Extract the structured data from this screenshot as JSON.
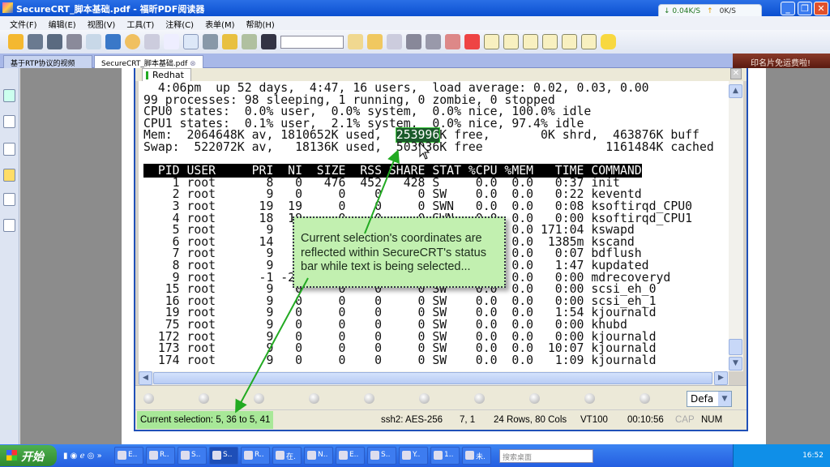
{
  "window": {
    "title": "SecureCRT_脚本基础.pdf - 福昕PDF阅读器",
    "minimize": "_",
    "restore": "❐",
    "close": "✕"
  },
  "netmon": {
    "down": "↓ 0.04K/S",
    "up": "↑",
    "up_value": "0K/S"
  },
  "menu": [
    "文件(F)",
    "编辑(E)",
    "视图(V)",
    "工具(T)",
    "注释(C)",
    "表单(M)",
    "帮助(H)"
  ],
  "tabs": [
    {
      "label": "基于RTP协议的视频流..."
    },
    {
      "label": "SecureCRT_脚本基础.pdf"
    }
  ],
  "ad": "印名片免运费啦!",
  "crt": {
    "session_tab": "Redhat",
    "terminal_top": [
      "  4:06pm  up 52 days,  4:47, 16 users,  load average: 0.02, 0.03, 0.00",
      "99 processes: 98 sleeping, 1 running, 0 zombie, 0 stopped",
      "CPU0 states:  0.0% user,  0.0% system,  0.0% nice, 100.0% idle",
      "CPU1 states:  0.1% user,  2.1% system,  0.0% nice, 97.4% idle"
    ],
    "mem_before": "Mem:  2064648K av, 1810652K used,  ",
    "mem_selected": "253996",
    "mem_after": "K free,       0K shrd,  463876K buff",
    "swap": "Swap:  522072K av,   18136K used,  503936K free                 1161484K cached",
    "header": "  PID USER     PRI  NI  SIZE  RSS SHARE STAT %CPU %MEM   TIME COMMAND",
    "rows": [
      "    1 root       8   0   476  452   428 S     0.0  0.0   0:37 init",
      "    2 root       9   0     0    0     0 SW    0.0  0.0   0:22 keventd",
      "    3 root      19  19     0    0     0 SWN   0.0  0.0   0:08 ksoftirqd_CPU0",
      "    4 root      18  19     0    0     0 SWN   0.0  0.0   0:00 ksoftirqd_CPU1",
      "    5 root       9   0     0    0     0 SW    0.0  0.0 171:04 kswapd",
      "    6 root      14   0     0    0     0 SW    0.0  0.0  1385m kscand",
      "    7 root       9   0     0    0     0 SW    0.0  0.0   0:07 bdflush",
      "    8 root       9   0     0    0     0 SW    0.0  0.0   1:47 kupdated",
      "    9 root      -1 -20     0    0     0 SW<   0.0  0.0   0:00 mdrecoveryd",
      "   15 root       9   0     0    0     0 SW    0.0  0.0   0:00 scsi_eh_0",
      "   16 root       9   0     0    0     0 SW    0.0  0.0   0:00 scsi_eh_1",
      "   19 root       9   0     0    0     0 SW    0.0  0.0   1:54 kjournald",
      "   75 root       9   0     0    0     0 SW    0.0  0.0   0:00 khubd",
      "  172 root       9   0     0    0     0 SW    0.0  0.0   0:00 kjournald",
      "  173 root       9   0     0    0     0 SW    0.0  0.0  10:07 kjournald",
      "  174 root       9   0     0    0     0 SW    0.0  0.0   1:09 kjournald"
    ],
    "button_bar_select": "Defa",
    "status": {
      "selection": "Current selection: 5, 36 to 5, 41",
      "cipher": "ssh2: AES-256",
      "cursor": "7,  1",
      "size": "24 Rows, 80 Cols",
      "emulation": "VT100",
      "elapsed": "00:10:56",
      "cap": "CAP",
      "num": "NUM"
    }
  },
  "callout": "Current selection's coordinates are reflected within SecureCRT's status bar while text is being selected...",
  "taskbar": {
    "start": "开始",
    "items": [
      "E..",
      "R..",
      "S..",
      "S..",
      "R..",
      "在.",
      "N..",
      "E..",
      "S..",
      "Y..",
      "1..",
      "未."
    ],
    "search_placeholder": "搜索桌面",
    "clock": "16:52"
  },
  "colors": {
    "accent": "#245ee0",
    "highlight": "#a8e898",
    "callout": "#c2f0b0",
    "arrow": "#22aa22"
  }
}
